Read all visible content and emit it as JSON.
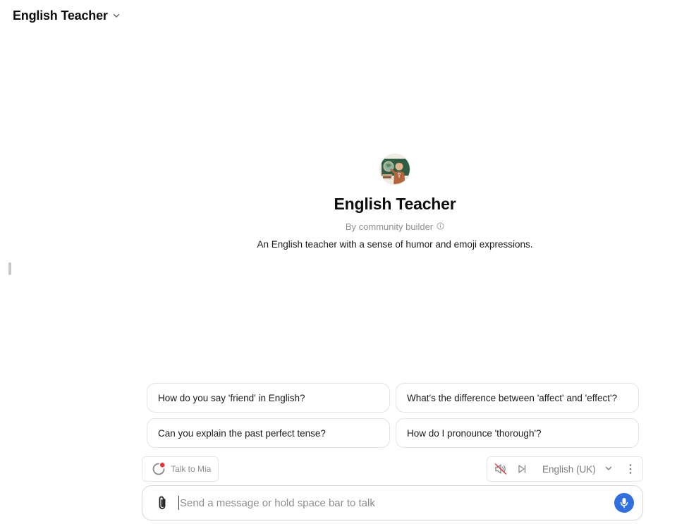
{
  "header": {
    "title": "English Teacher",
    "dropdown_icon": "chevron-down-icon"
  },
  "gpt": {
    "name": "English Teacher",
    "byline": "By community builder",
    "byline_icon": "info-icon",
    "description": "An English teacher with a sense of humor and emoji expressions."
  },
  "suggestions": [
    "How do you say 'friend' in English?",
    "What's the difference between 'affect' and 'effect'?",
    "Can you explain the past perfect tense?",
    "How do I pronounce 'thorough'?"
  ],
  "voice": {
    "talk_label": "Talk to Mia",
    "recording_dot_color": "#e5383b",
    "mute_icon": "speaker-muted-icon",
    "skip_icon": "skip-forward-icon",
    "language": "English (UK)",
    "more_icon": "more-vertical-icon"
  },
  "composer": {
    "placeholder": "Send a message or hold space bar to talk",
    "value": "",
    "attach_icon": "paperclip-icon",
    "mic_icon": "microphone-icon",
    "mic_color": "#2f6fe0"
  }
}
